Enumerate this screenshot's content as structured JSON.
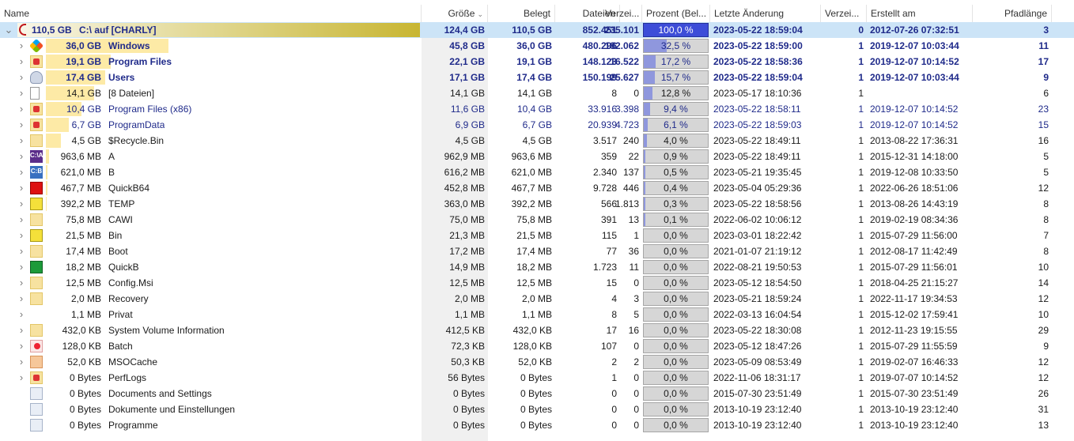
{
  "columns": {
    "name": "Name",
    "groesse": "Größe",
    "belegt": "Belegt",
    "dateien": "Dateien",
    "verzeichnisse": "Verzei...",
    "prozent": "Prozent (Bel...",
    "letzte_aenderung": "Letzte Änderung",
    "verzei2": "Verzei...",
    "erstellt": "Erstellt am",
    "pfadlaenge": "Pfadlänge"
  },
  "root": {
    "icon": "drive-icon",
    "size": "110,5 GB",
    "name": "C:\\  auf  [CHARLY]",
    "groesse": "124,4 GB",
    "belegt": "110,5 GB",
    "dateien": "852.451",
    "verz": "235.101",
    "prozent": "100,0 %",
    "geaendert": "2023-05-22 18:59:04",
    "verz2": "0",
    "erstellt": "2012-07-26 07:32:51",
    "pfad": "3"
  },
  "rows": [
    {
      "icon": "windows-icon",
      "size": "36,0 GB",
      "bar": 32.5,
      "name": "Windows",
      "groesse": "45,8 GB",
      "belegt": "36,0 GB",
      "dateien": "480.296",
      "verz": "182.062",
      "pct": 32.5,
      "prozent": "32,5 %",
      "geaendert": "2023-05-22 18:59:00",
      "verz2": "1",
      "erstellt": "2019-12-07 10:03:44",
      "pfad": "11",
      "style": "bold",
      "caret": "›"
    },
    {
      "icon": "system-folder-icon",
      "size": "19,1 GB",
      "bar": 17.2,
      "name": "Program Files",
      "groesse": "22,1 GB",
      "belegt": "19,1 GB",
      "dateien": "148.123",
      "verz": "16.522",
      "pct": 17.2,
      "prozent": "17,2 %",
      "geaendert": "2023-05-22 18:58:36",
      "verz2": "1",
      "erstellt": "2019-12-07 10:14:52",
      "pfad": "17",
      "style": "bold",
      "caret": "›"
    },
    {
      "icon": "users-icon",
      "size": "17,4 GB",
      "bar": 15.7,
      "name": "Users",
      "groesse": "17,1 GB",
      "belegt": "17,4 GB",
      "dateien": "150.199",
      "verz": "25.627",
      "pct": 15.7,
      "prozent": "15,7 %",
      "geaendert": "2023-05-22 18:59:04",
      "verz2": "1",
      "erstellt": "2019-12-07 10:03:44",
      "pfad": "9",
      "style": "bold",
      "caret": "›"
    },
    {
      "icon": "file-icon",
      "size": "14,1 GB",
      "bar": 12.8,
      "name": "[8 Dateien]",
      "groesse": "14,1 GB",
      "belegt": "14,1 GB",
      "dateien": "8",
      "verz": "0",
      "pct": 12.8,
      "prozent": "12,8 %",
      "geaendert": "2023-05-17 18:10:36",
      "verz2": "1",
      "erstellt": "",
      "pfad": "6",
      "style": "plain",
      "caret": "›"
    },
    {
      "icon": "system-folder-icon",
      "size": "10,4 GB",
      "bar": 9.4,
      "name": "Program Files (x86)",
      "groesse": "11,6 GB",
      "belegt": "10,4 GB",
      "dateien": "33.916",
      "verz": "3.398",
      "pct": 9.4,
      "prozent": "9,4 %",
      "geaendert": "2023-05-22 18:58:11",
      "verz2": "1",
      "erstellt": "2019-12-07 10:14:52",
      "pfad": "23",
      "style": "blue",
      "caret": "›"
    },
    {
      "icon": "system-folder-icon",
      "size": "6,7 GB",
      "bar": 6.1,
      "name": "ProgramData",
      "groesse": "6,9 GB",
      "belegt": "6,7 GB",
      "dateien": "20.939",
      "verz": "4.723",
      "pct": 6.1,
      "prozent": "6,1 %",
      "geaendert": "2023-05-22 18:59:03",
      "verz2": "1",
      "erstellt": "2019-12-07 10:14:52",
      "pfad": "15",
      "style": "blue",
      "caret": "›"
    },
    {
      "icon": "folder-icon",
      "size": "4,5 GB",
      "bar": 4.0,
      "name": "$Recycle.Bin",
      "groesse": "4,5 GB",
      "belegt": "4,5 GB",
      "dateien": "3.517",
      "verz": "240",
      "pct": 4.0,
      "prozent": "4,0 %",
      "geaendert": "2023-05-22 18:49:11",
      "verz2": "1",
      "erstellt": "2013-08-22 17:36:31",
      "pfad": "16",
      "style": "plain",
      "caret": "›"
    },
    {
      "icon": "a-label-icon",
      "iconText": "C:\\A",
      "size": "963,6 MB",
      "bar": 0.9,
      "name": "A",
      "groesse": "962,9 MB",
      "belegt": "963,6 MB",
      "dateien": "359",
      "verz": "22",
      "pct": 0.9,
      "prozent": "0,9 %",
      "geaendert": "2023-05-22 18:49:11",
      "verz2": "1",
      "erstellt": "2015-12-31 14:18:00",
      "pfad": "5",
      "style": "plain",
      "caret": "›"
    },
    {
      "icon": "b-label-icon",
      "iconText": "C:B",
      "size": "621,0 MB",
      "bar": 0.5,
      "name": "B",
      "groesse": "616,2 MB",
      "belegt": "621,0 MB",
      "dateien": "2.340",
      "verz": "137",
      "pct": 0.5,
      "prozent": "0,5 %",
      "geaendert": "2023-05-21 19:35:45",
      "verz2": "1",
      "erstellt": "2019-12-08 10:33:50",
      "pfad": "5",
      "style": "plain",
      "caret": "›"
    },
    {
      "icon": "quickb-red-icon",
      "size": "467,7 MB",
      "bar": 0.4,
      "name": "QuickB64",
      "groesse": "452,8 MB",
      "belegt": "467,7 MB",
      "dateien": "9.728",
      "verz": "446",
      "pct": 0.4,
      "prozent": "0,4 %",
      "geaendert": "2023-05-04 05:29:36",
      "verz2": "1",
      "erstellt": "2022-06-26 18:51:06",
      "pfad": "12",
      "style": "plain",
      "caret": "›"
    },
    {
      "icon": "temp-yellow-icon",
      "size": "392,2 MB",
      "bar": 0.3,
      "name": "TEMP",
      "groesse": "363,0 MB",
      "belegt": "392,2 MB",
      "dateien": "566",
      "verz": "1.813",
      "pct": 0.3,
      "prozent": "0,3 %",
      "geaendert": "2023-05-22 18:58:56",
      "verz2": "1",
      "erstellt": "2013-08-26 14:43:19",
      "pfad": "8",
      "style": "plain",
      "caret": "›"
    },
    {
      "icon": "cawi-icon",
      "size": "75,8 MB",
      "bar": 0.1,
      "name": "CAWI",
      "groesse": "75,0 MB",
      "belegt": "75,8 MB",
      "dateien": "391",
      "verz": "13",
      "pct": 0.1,
      "prozent": "0,1 %",
      "geaendert": "2022-06-02 10:06:12",
      "verz2": "1",
      "erstellt": "2019-02-19 08:34:36",
      "pfad": "8",
      "style": "plain",
      "caret": "›"
    },
    {
      "icon": "bin-yellow-icon",
      "size": "21,5 MB",
      "bar": 0,
      "name": "Bin",
      "groesse": "21,3 MB",
      "belegt": "21,5 MB",
      "dateien": "115",
      "verz": "1",
      "pct": 0,
      "prozent": "0,0 %",
      "geaendert": "2023-03-01 18:22:42",
      "verz2": "1",
      "erstellt": "2015-07-29 11:56:00",
      "pfad": "7",
      "style": "plain",
      "caret": "›"
    },
    {
      "icon": "folder-icon",
      "size": "17,4 MB",
      "bar": 0,
      "name": "Boot",
      "groesse": "17,2 MB",
      "belegt": "17,4 MB",
      "dateien": "77",
      "verz": "36",
      "pct": 0,
      "prozent": "0,0 %",
      "geaendert": "2021-01-07 21:19:12",
      "verz2": "1",
      "erstellt": "2012-08-17 11:42:49",
      "pfad": "8",
      "style": "plain",
      "caret": "›"
    },
    {
      "icon": "quickb-green-icon",
      "size": "18,2 MB",
      "bar": 0,
      "name": "QuickB",
      "groesse": "14,9 MB",
      "belegt": "18,2 MB",
      "dateien": "1.723",
      "verz": "11",
      "pct": 0,
      "prozent": "0,0 %",
      "geaendert": "2022-08-21 19:50:53",
      "verz2": "1",
      "erstellt": "2015-07-29 11:56:01",
      "pfad": "10",
      "style": "plain",
      "caret": "›"
    },
    {
      "icon": "folder-icon",
      "size": "12,5 MB",
      "bar": 0,
      "name": "Config.Msi",
      "groesse": "12,5 MB",
      "belegt": "12,5 MB",
      "dateien": "15",
      "verz": "0",
      "pct": 0,
      "prozent": "0,0 %",
      "geaendert": "2023-05-12 18:54:50",
      "verz2": "1",
      "erstellt": "2018-04-25 21:15:27",
      "pfad": "14",
      "style": "plain",
      "caret": "›"
    },
    {
      "icon": "folder-icon",
      "size": "2,0 MB",
      "bar": 0,
      "name": "Recovery",
      "groesse": "2,0 MB",
      "belegt": "2,0 MB",
      "dateien": "4",
      "verz": "3",
      "pct": 0,
      "prozent": "0,0 %",
      "geaendert": "2023-05-21 18:59:24",
      "verz2": "1",
      "erstellt": "2022-11-17 19:34:53",
      "pfad": "12",
      "style": "plain",
      "caret": "›"
    },
    {
      "icon": "privat-icon",
      "size": "1,1 MB",
      "bar": 0,
      "name": "Privat",
      "groesse": "1,1 MB",
      "belegt": "1,1 MB",
      "dateien": "8",
      "verz": "5",
      "pct": 0,
      "prozent": "0,0 %",
      "geaendert": "2022-03-13 16:04:54",
      "verz2": "1",
      "erstellt": "2015-12-02 17:59:41",
      "pfad": "10",
      "style": "plain",
      "caret": "›"
    },
    {
      "icon": "folder-icon",
      "size": "432,0 KB",
      "bar": 0,
      "name": "System Volume Information",
      "groesse": "412,5 KB",
      "belegt": "432,0 KB",
      "dateien": "17",
      "verz": "16",
      "pct": 0,
      "prozent": "0,0 %",
      "geaendert": "2023-05-22 18:30:08",
      "verz2": "1",
      "erstellt": "2012-11-23 19:15:55",
      "pfad": "29",
      "style": "plain",
      "caret": "›"
    },
    {
      "icon": "batch-icon",
      "size": "128,0 KB",
      "bar": 0,
      "name": "Batch",
      "groesse": "72,3 KB",
      "belegt": "128,0 KB",
      "dateien": "107",
      "verz": "0",
      "pct": 0,
      "prozent": "0,0 %",
      "geaendert": "2023-05-12 18:47:26",
      "verz2": "1",
      "erstellt": "2015-07-29 11:55:59",
      "pfad": "9",
      "style": "plain",
      "caret": "›"
    },
    {
      "icon": "msocache-icon",
      "size": "52,0 KB",
      "bar": 0,
      "name": "MSOCache",
      "groesse": "50,3 KB",
      "belegt": "52,0 KB",
      "dateien": "2",
      "verz": "2",
      "pct": 0,
      "prozent": "0,0 %",
      "geaendert": "2023-05-09 08:53:49",
      "verz2": "1",
      "erstellt": "2019-02-07 16:46:33",
      "pfad": "12",
      "style": "plain",
      "caret": "›"
    },
    {
      "icon": "perflogs-icon",
      "size": "0 Bytes",
      "bar": 0,
      "name": "PerfLogs",
      "groesse": "56 Bytes",
      "belegt": "0 Bytes",
      "dateien": "1",
      "verz": "0",
      "pct": 0,
      "prozent": "0,0 %",
      "geaendert": "2022-11-06 18:31:17",
      "verz2": "1",
      "erstellt": "2019-07-07 10:14:52",
      "pfad": "12",
      "style": "plain",
      "caret": "›"
    },
    {
      "icon": "link-folder-icon",
      "size": "0 Bytes",
      "bar": 0,
      "name": "Documents and Settings",
      "groesse": "0 Bytes",
      "belegt": "0 Bytes",
      "dateien": "0",
      "verz": "0",
      "pct": 0,
      "prozent": "0,0 %",
      "geaendert": "2015-07-30 23:51:49",
      "verz2": "1",
      "erstellt": "2015-07-30 23:51:49",
      "pfad": "26",
      "style": "plain",
      "caret": ""
    },
    {
      "icon": "link-folder-icon",
      "size": "0 Bytes",
      "bar": 0,
      "name": "Dokumente und Einstellungen",
      "groesse": "0 Bytes",
      "belegt": "0 Bytes",
      "dateien": "0",
      "verz": "0",
      "pct": 0,
      "prozent": "0,0 %",
      "geaendert": "2013-10-19 23:12:40",
      "verz2": "1",
      "erstellt": "2013-10-19 23:12:40",
      "pfad": "31",
      "style": "plain",
      "caret": ""
    },
    {
      "icon": "link-folder-icon",
      "size": "0 Bytes",
      "bar": 0,
      "name": "Programme",
      "groesse": "0 Bytes",
      "belegt": "0 Bytes",
      "dateien": "0",
      "verz": "0",
      "pct": 0,
      "prozent": "0,0 %",
      "geaendert": "2013-10-19 23:12:40",
      "verz2": "1",
      "erstellt": "2013-10-19 23:12:40",
      "pfad": "13",
      "style": "plain",
      "caret": ""
    }
  ],
  "colors": {
    "selected_row": "#cce4f7",
    "size_bar": "#fdeaa6",
    "percent_fill": "#8f97dd",
    "percent_full": "#3d4dd8",
    "bold_text": "#1f2a8a"
  }
}
